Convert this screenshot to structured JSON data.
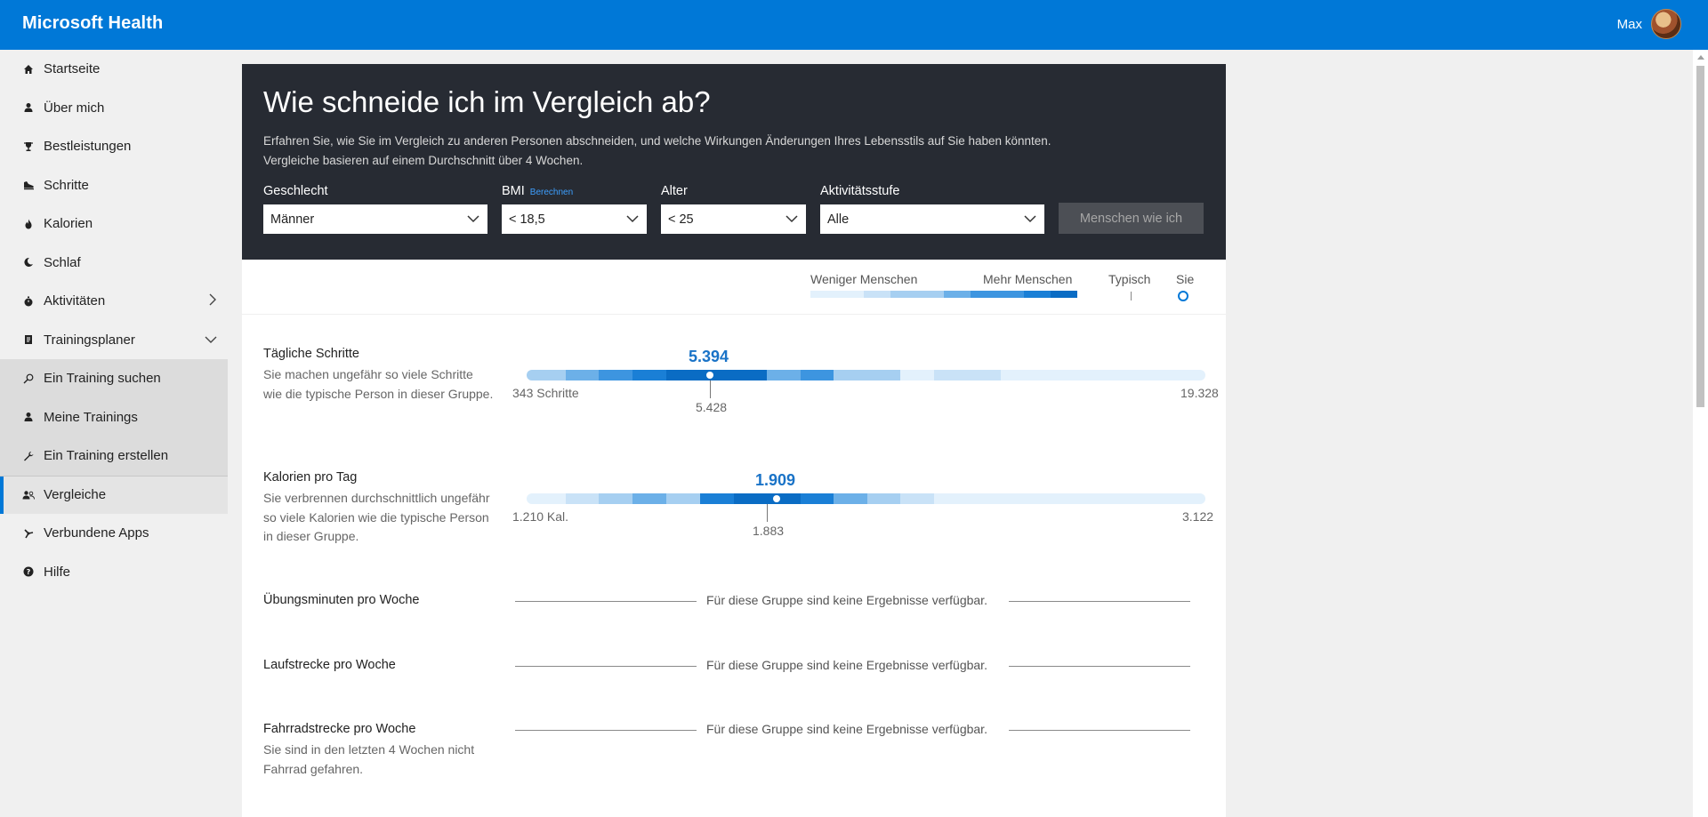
{
  "app": {
    "title": "Microsoft Health",
    "user_name": "Max"
  },
  "sidebar": {
    "items": [
      {
        "label": "Startseite",
        "icon": "home-icon"
      },
      {
        "label": "Über mich",
        "icon": "person-icon"
      },
      {
        "label": "Bestleistungen",
        "icon": "trophy-icon"
      },
      {
        "label": "Schritte",
        "icon": "shoe-icon"
      },
      {
        "label": "Kalorien",
        "icon": "flame-icon"
      },
      {
        "label": "Schlaf",
        "icon": "moon-icon"
      },
      {
        "label": "Aktivitäten",
        "icon": "stopwatch-icon"
      },
      {
        "label": "Trainingsplaner",
        "icon": "planner-icon"
      },
      {
        "label": "Ein Training suchen",
        "icon": "search-icon"
      },
      {
        "label": "Meine Trainings",
        "icon": "person-icon"
      },
      {
        "label": "Ein Training erstellen",
        "icon": "wrench-icon"
      },
      {
        "label": "Vergleiche",
        "icon": "people-icon"
      },
      {
        "label": "Verbundene Apps",
        "icon": "apps-icon"
      },
      {
        "label": "Hilfe",
        "icon": "help-icon"
      }
    ]
  },
  "hero": {
    "title": "Wie schneide ich im Vergleich ab?",
    "desc_line1": "Erfahren Sie, wie Sie im Vergleich zu anderen Personen abschneiden, und welche Wirkungen Änderungen Ihres Lebensstils auf Sie haben könnten.",
    "desc_line2": "Vergleiche basieren auf einem Durchschnitt über 4 Wochen."
  },
  "filters": {
    "gender": {
      "label": "Geschlecht",
      "value": "Männer"
    },
    "bmi": {
      "label": "BMI",
      "link": "Berechnen",
      "value": "< 18,5"
    },
    "age": {
      "label": "Alter",
      "value": "< 25"
    },
    "activity": {
      "label": "Aktivitätsstufe",
      "value": "Alle"
    },
    "button": "Menschen wie ich"
  },
  "legend": {
    "less": "Weniger Menschen",
    "more": "Mehr Menschen",
    "typical": "Typisch",
    "you": "Sie"
  },
  "metrics": {
    "steps": {
      "title": "Tägliche Schritte",
      "desc": "Sie machen ungefähr so viele Schritte wie die typische Person in dieser Gruppe.",
      "you": "5.394",
      "typical": "5.428",
      "min": "343 Schritte",
      "max": "19.328",
      "you_fraction": 0.271,
      "typical_fraction": 0.272
    },
    "calories": {
      "title": "Kalorien pro Tag",
      "desc": "Sie verbrennen durchschnittlich ungefähr so viele Kalorien wie die typische Person in dieser Gruppe.",
      "you": "1.909",
      "typical": "1.883",
      "min": "1.210 Kal.",
      "max": "3.122",
      "you_fraction": 0.365,
      "typical_fraction": 0.352
    },
    "exercise": {
      "title": "Übungsminuten pro Woche",
      "no_results": "Für diese Gruppe sind keine Ergebnisse verfügbar."
    },
    "running": {
      "title": "Laufstrecke pro Woche",
      "no_results": "Für diese Gruppe sind keine Ergebnisse verfügbar."
    },
    "cycling": {
      "title": "Fahrradstrecke pro Woche",
      "desc": "Sie sind in den letzten 4 Wochen nicht Fahrrad gefahren.",
      "no_results": "Für diese Gruppe sind keine Ergebnisse verfügbar."
    }
  },
  "colors": {
    "accent": "#0078d7",
    "hero_bg": "#272b33",
    "density_scale": [
      "#e3f1fc",
      "#c9e2f7",
      "#a6cff1",
      "#6cb0e8",
      "#3d95e0",
      "#1a7fd6",
      "#0a6cc4"
    ]
  }
}
